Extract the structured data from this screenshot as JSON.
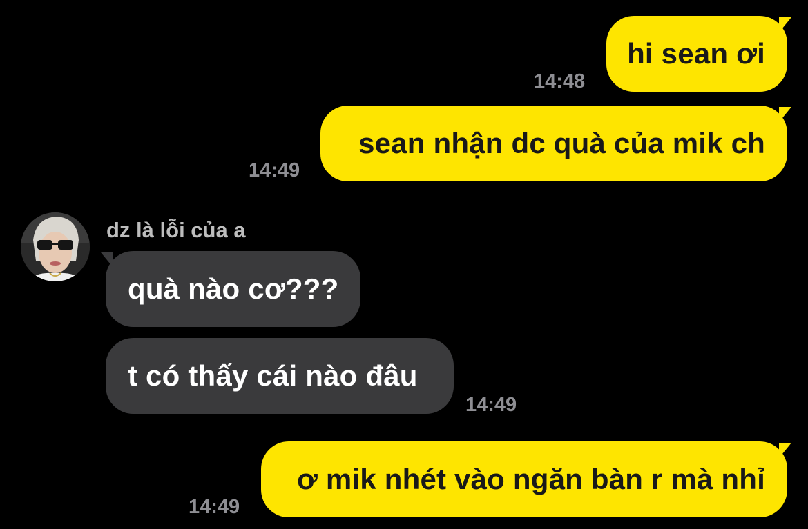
{
  "colors": {
    "background": "#000000",
    "outgoing_bubble": "#FEE500",
    "outgoing_text": "#191919",
    "incoming_bubble": "#3A3A3C",
    "incoming_text": "#FFFFFF",
    "timestamp": "#8E8E93",
    "sender_name": "#BDBDBD"
  },
  "messages": [
    {
      "direction": "outgoing",
      "text": "hi sean ơi",
      "time": "14:48"
    },
    {
      "direction": "outgoing",
      "text": "sean nhận dc quà của mik ch",
      "time": "14:49"
    },
    {
      "direction": "incoming",
      "sender": "dz là lỗi của a",
      "avatar_icon": "profile-photo",
      "text": "quà nào cơ???"
    },
    {
      "direction": "incoming",
      "text": "t có thấy cái nào đâu",
      "time": "14:49"
    },
    {
      "direction": "outgoing",
      "text": "ơ mik nhét vào ngăn bàn r mà nhỉ",
      "time": "14:49"
    }
  ]
}
